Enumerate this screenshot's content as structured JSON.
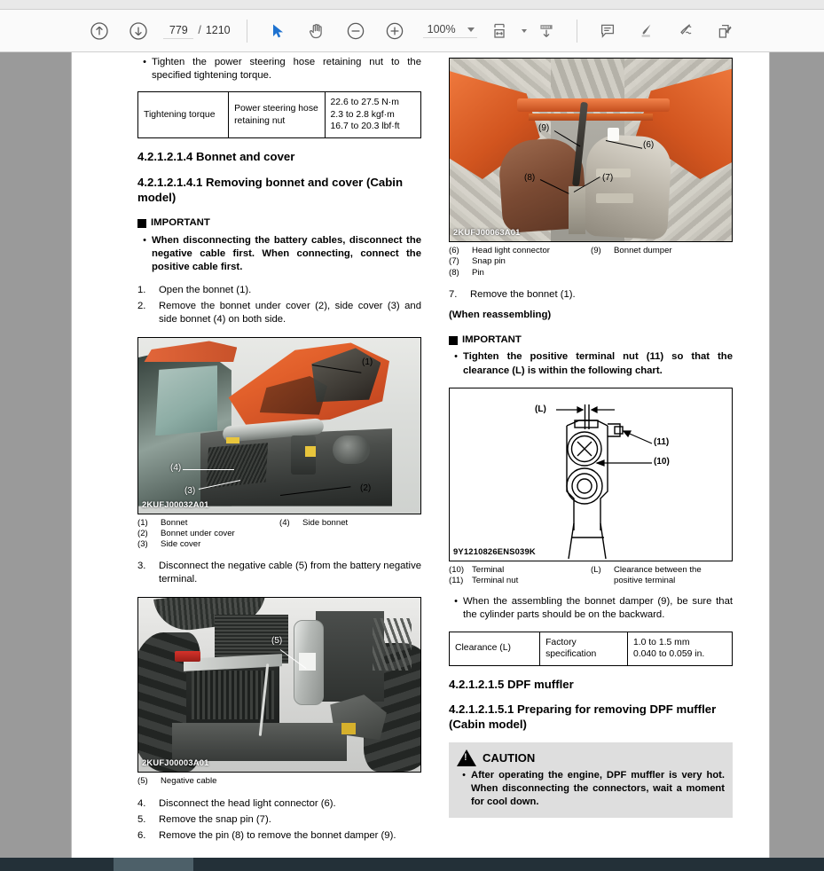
{
  "toolbar": {
    "prev_page_icon": "arrow-up-circle-icon",
    "next_page_icon": "arrow-down-circle-icon",
    "current_page": "779",
    "page_separator": "/",
    "total_pages": "1210",
    "select_tool_icon": "cursor-arrow-icon",
    "hand_tool_icon": "hand-icon",
    "zoom_out_icon": "minus-circle-icon",
    "zoom_in_icon": "plus-circle-icon",
    "zoom_level": "100%",
    "zoom_dropdown_icon": "chevron-down-icon",
    "fit_page_icon": "fit-page-icon",
    "fit_dropdown_icon": "chevron-down-icon",
    "scroll_mode_icon": "scroll-down-icon",
    "comment_icon": "comment-icon",
    "highlight_icon": "highlighter-icon",
    "draw_icon": "freehand-draw-icon",
    "signature_icon": "fill-and-sign-icon"
  },
  "document": {
    "left_column": {
      "intro_bullet": "Tighten the power steering hose retaining nut to the specified tightening torque.",
      "torque_table": {
        "label": "Tightening torque",
        "item": "Power steering hose retaining nut",
        "values": "22.6 to 27.5 N·m\n2.3 to 2.8 kgf·m\n16.7 to 20.3 lbf·ft"
      },
      "heading_1": "4.2.1.2.1.4 Bonnet and cover",
      "heading_2": "4.2.1.2.1.4.1 Removing bonnet and cover (Cabin model)",
      "important_label": "IMPORTANT",
      "important_bullet": "When disconnecting the battery cables, disconnect the negative cable first. When connecting, connect the positive cable first.",
      "step_1_num": "1.",
      "step_1_text": "Open the bonnet (1).",
      "step_2_num": "2.",
      "step_2_text": "Remove the bonnet under cover (2), side cover (3) and side bonnet (4) on both side.",
      "figure_1_code": "2KUFJ00032A01",
      "figure_1_callouts": [
        "(1)",
        "(2)",
        "(3)",
        "(4)"
      ],
      "figure_1_legend": [
        {
          "key": "(1)",
          "value": "Bonnet"
        },
        {
          "key": "(4)",
          "value": "Side bonnet"
        },
        {
          "key": "(2)",
          "value": "Bonnet under cover"
        },
        {
          "key": "(3)",
          "value": "Side cover"
        }
      ],
      "step_3_num": "3.",
      "step_3_text": "Disconnect the negative cable (5) from the battery negative terminal.",
      "figure_2_code": "2KUFJ00003A01",
      "figure_2_callouts": [
        "(5)"
      ],
      "figure_2_legend": [
        {
          "key": "(5)",
          "value": "Negative cable"
        }
      ],
      "step_4_num": "4.",
      "step_4_text": "Disconnect the head light connector (6).",
      "step_5_num": "5.",
      "step_5_text": "Remove the snap pin (7).",
      "step_6_num": "6.",
      "step_6_text": "Remove the pin (8) to remove the bonnet damper (9)."
    },
    "right_column": {
      "figure_3_code": "2KUFJ00063A01",
      "figure_3_callouts": [
        "(6)",
        "(7)",
        "(8)",
        "(9)"
      ],
      "figure_3_legend": [
        {
          "key": "(6)",
          "value": "Head light connector"
        },
        {
          "key": "(9)",
          "value": "Bonnet dumper"
        },
        {
          "key": "(7)",
          "value": "Snap pin"
        },
        {
          "key": "(8)",
          "value": "Pin"
        }
      ],
      "step_7_num": "7.",
      "step_7_text": "Remove the bonnet (1).",
      "reassembling_heading": "(When reassembling)",
      "important_label": "IMPORTANT",
      "important_bullet": "Tighten the positive terminal nut (11) so that the clearance (L) is within the following chart.",
      "figure_4_code": "9Y1210826ENS039K",
      "figure_4_callouts": [
        "(L)",
        "(11)",
        "(10)"
      ],
      "figure_4_legend": [
        {
          "key": "(10)",
          "value": "Terminal"
        },
        {
          "key": "(L)",
          "value": "Clearance between the positive terminal"
        },
        {
          "key": "(11)",
          "value": "Terminal nut"
        }
      ],
      "damper_bullet": "When the assembling the bonnet damper (9), be sure that the cylinder parts should be on the backward.",
      "clearance_table": {
        "label": "Clearance (L)",
        "item": "Factory specification",
        "values": "1.0 to 1.5 mm\n0.040 to 0.059 in."
      },
      "heading_3": "4.2.1.2.1.5 DPF muffler",
      "heading_4": "4.2.1.2.1.5.1 Preparing for removing DPF muffler (Cabin model)",
      "caution_label": "CAUTION",
      "caution_icon": "warning-triangle-icon",
      "caution_bullet": "After operating the engine, DPF muffler is very hot. When disconnecting the connectors, wait a moment for cool down."
    }
  },
  "colors": {
    "accent_blue": "#1e72d0",
    "toolbar_bg": "#fafafa",
    "viewer_bg": "#9a9a9a",
    "taskbar_bg": "#233038"
  }
}
